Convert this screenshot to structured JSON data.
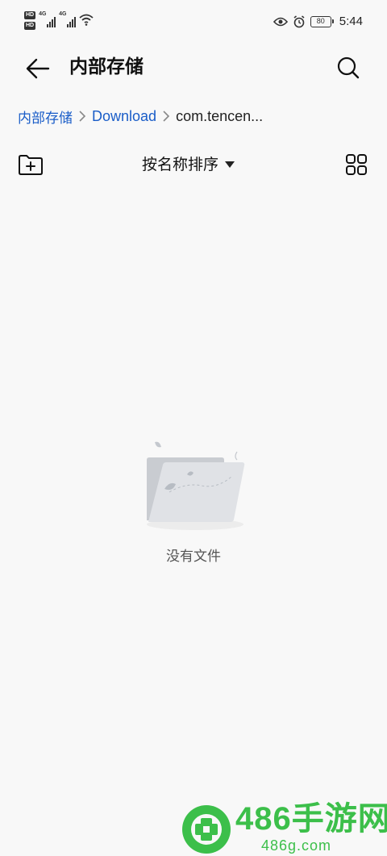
{
  "status_bar": {
    "network_badge_1": "HD",
    "network_badge_2": "HD",
    "signal_1_type": "4G",
    "signal_2_type": "4G",
    "battery_level": "80",
    "time": "5:44",
    "icons": [
      "wifi-icon",
      "eye-icon",
      "alarm-icon",
      "battery-icon"
    ]
  },
  "header": {
    "title": "内部存储",
    "back_icon": "arrow-left-icon",
    "search_icon": "search-icon"
  },
  "breadcrumb": {
    "items": [
      {
        "label": "内部存储"
      },
      {
        "label": "Download"
      },
      {
        "label": "com.tencen..."
      }
    ]
  },
  "toolbar": {
    "new_folder_icon": "folder-add-icon",
    "sort_label": "按名称排序",
    "view_icon": "grid-view-icon"
  },
  "empty_state": {
    "message": "没有文件",
    "illustration": "empty-folder-illustration"
  },
  "watermark": {
    "main": "486手游网",
    "sub": "486g.com"
  },
  "colors": {
    "background": "#f8f8f8",
    "link": "#1a5dc8",
    "watermark": "#3cbf4a"
  }
}
